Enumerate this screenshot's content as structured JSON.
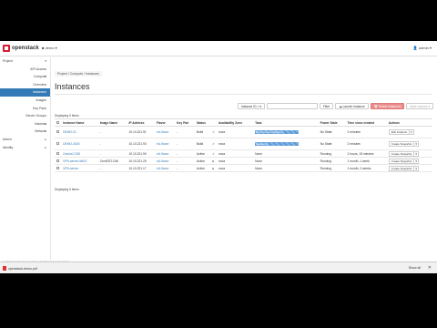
{
  "header": {
    "logo_text": "openstack",
    "project_selector": "■ demo ▾",
    "user_selector": "👤 admin ▾"
  },
  "sidebar": {
    "items": [
      {
        "label": "Project",
        "style": "left",
        "caret": "▾"
      },
      {
        "label": "API Access",
        "style": "",
        "caret": ""
      },
      {
        "label": "Compute",
        "style": "",
        "caret": "▾"
      },
      {
        "label": "Overview",
        "style": "",
        "caret": ""
      },
      {
        "label": "Instances",
        "style": "active",
        "caret": ""
      },
      {
        "label": "Images",
        "style": "",
        "caret": ""
      },
      {
        "label": "Key Pairs",
        "style": "",
        "caret": ""
      },
      {
        "label": "Server Groups",
        "style": "",
        "caret": ""
      },
      {
        "label": "Volumes",
        "style": "",
        "caret": "▸"
      },
      {
        "label": "Network",
        "style": "",
        "caret": "▸"
      },
      {
        "label": "Admin",
        "style": "left",
        "caret": "▸"
      },
      {
        "label": "Identity",
        "style": "left",
        "caret": "▸"
      }
    ]
  },
  "main": {
    "breadcrumb": "Project / Compute / Instances",
    "title": "Instances",
    "filter": {
      "select_label": "Instance ID = ▾",
      "filter_button": "Filter",
      "launch_button": "☁ Launch Instance",
      "delete_button": "🗑 Delete Instances",
      "more_button": "More Actions ▾"
    },
    "display_count": "Displaying 5 items",
    "columns": [
      "",
      "Instance Name",
      "Image Name",
      "IP Address",
      "Flavor",
      "Key Pair",
      "Status",
      "",
      "Availability Zone",
      "Task",
      "Power State",
      "Time since created",
      "Actions"
    ],
    "rows": [
      {
        "name": "DEMO-01",
        "image": "-",
        "ip": "10.10.221.91",
        "flavor": "m1.flavor",
        "key": "-",
        "status": "Build",
        "check": "✓",
        "zone": "nova",
        "task": "Block Device Mapping",
        "task_bar": true,
        "power": "No State",
        "age": "2 minutes",
        "action": "Edit Instance"
      },
      {
        "name": "DEMO-4026",
        "image": "-",
        "ip": "10.10.221.93",
        "flavor": "m1.flavor",
        "key": "-",
        "status": "Build",
        "check": "✓",
        "zone": "nova",
        "task": "Spawning",
        "task_bar": true,
        "power": "No State",
        "age": "2 minutes",
        "action": "Create Snapshot"
      },
      {
        "name": "Centos7-DW",
        "image": "-",
        "ip": "10.10.221.90",
        "flavor": "m1.flavor",
        "key": "-",
        "status": "Active",
        "check": "✓",
        "zone": "nova",
        "task": "None",
        "task_bar": false,
        "power": "Running",
        "age": "2 hours, 15 minutes",
        "action": "Create Snapshot"
      },
      {
        "name": "VPN-server-WIN7",
        "image": "CentOS7-DW",
        "ip": "10.10.221.25",
        "flavor": "m1.flavor",
        "key": "-",
        "status": "Active",
        "check": "●",
        "zone": "nova",
        "task": "None",
        "task_bar": false,
        "power": "Running",
        "age": "1 month, 1 week",
        "action": "Create Snapshot"
      },
      {
        "name": "VPN-server",
        "image": "-",
        "ip": "10.10.221.17",
        "flavor": "m1.flavor",
        "key": "-",
        "status": "Active",
        "check": "●",
        "zone": "nova",
        "task": "None",
        "task_bar": false,
        "power": "Running",
        "age": "1 month, 2 weeks",
        "action": "Create Snapshot"
      }
    ]
  },
  "footer": {
    "text": "© 2020 OpenStack Foundation | Dashboard for OpenStack"
  },
  "download": {
    "filename": "openstack-demo.pdf",
    "show_all": "Show all",
    "close": "✕"
  }
}
